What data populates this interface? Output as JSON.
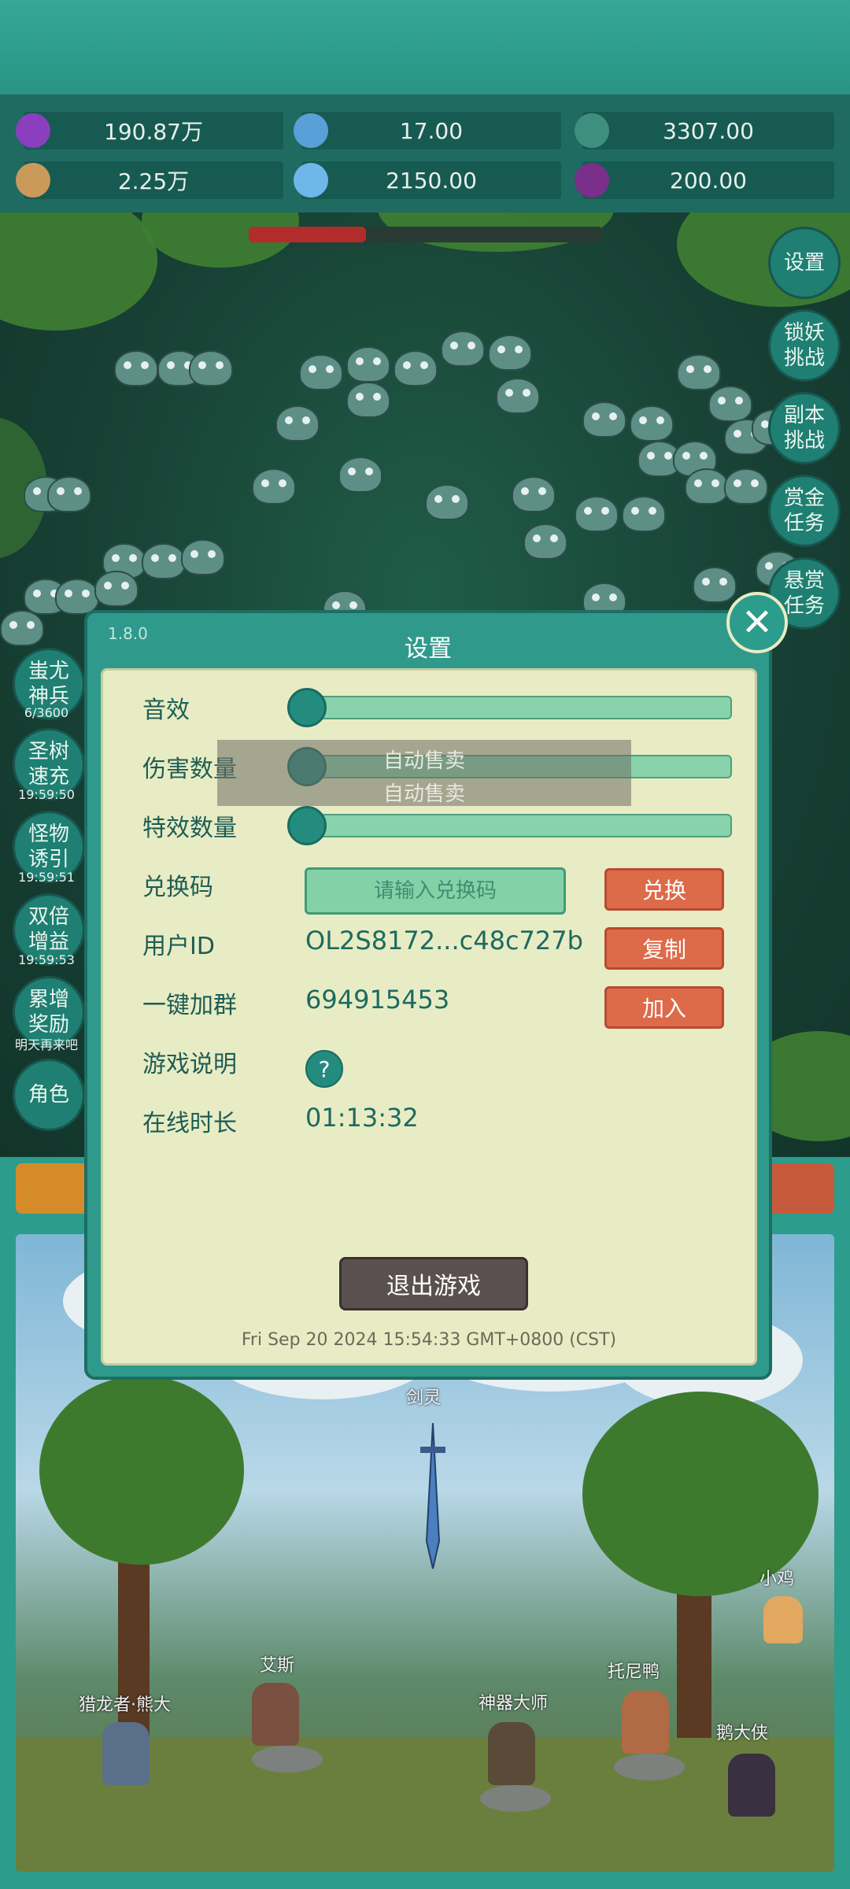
{
  "resources": [
    {
      "icon": "purple-gem-icon",
      "value": "190.87万"
    },
    {
      "icon": "blue-crystal-icon",
      "value": "17.00"
    },
    {
      "icon": "teal-orb-icon",
      "value": "3307.00"
    },
    {
      "icon": "scroll-icon",
      "value": "2.25万"
    },
    {
      "icon": "ice-shard-icon",
      "value": "2150.00"
    },
    {
      "icon": "purple-orb-icon",
      "value": "200.00"
    }
  ],
  "right_menu": {
    "settings": "设置",
    "lock_challenge": [
      "锁妖",
      "挑战"
    ],
    "dungeon_challenge": [
      "副本",
      "挑战"
    ],
    "gold_task": [
      "赏金",
      "任务"
    ],
    "bounty_task": [
      "悬赏",
      "任务"
    ]
  },
  "left_menu": {
    "chiyou": [
      "蚩尤",
      "神兵"
    ],
    "chiyou_count": "6/3600",
    "holy_tree": [
      "圣树",
      "速充"
    ],
    "holy_tree_timer": "19:59:50",
    "monster_lure": [
      "怪物",
      "诱引"
    ],
    "monster_lure_timer": "19:59:51",
    "double_gain": [
      "双倍",
      "增益"
    ],
    "double_gain_timer": "19:59:53",
    "accum_reward": [
      "累增",
      "奖励"
    ],
    "accum_reward_note": "明天再来吧",
    "character": "角色"
  },
  "settings_dialog": {
    "version": "1.8.0",
    "title": "设置",
    "sound_label": "音效",
    "damage_label": "伤害数量",
    "effects_label": "特效数量",
    "redeem_label": "兑换码",
    "redeem_placeholder": "请输入兑换码",
    "redeem_button": "兑换",
    "user_id_label": "用户ID",
    "user_id_value": "OL2S8172...c48c727b",
    "copy_button": "复制",
    "join_group_label": "一键加群",
    "join_group_value": "694915453",
    "join_button": "加入",
    "game_guide_label": "游戏说明",
    "help_icon": "?",
    "online_time_label": "在线时长",
    "online_time_value": "01:13:32",
    "exit_button": "退出游戏",
    "date_text": "Fri Sep 20 2024 15:54:33 GMT+0800 (CST)",
    "sound_level": 0,
    "damage_level": 0,
    "effects_level": 0
  },
  "toast": {
    "line1": "自动售卖",
    "line2": "自动售卖"
  },
  "scene_npcs": {
    "sword_spirit": "剑灵",
    "dragon_hunter": "猎龙者·熊大",
    "aisi": "艾斯",
    "artifact_master": "神器大师",
    "tony_duck": "托尼鸭",
    "little_chicken": "小鸡",
    "goose_hero": "鹅大侠"
  },
  "boss_hp_fraction": 0.33
}
